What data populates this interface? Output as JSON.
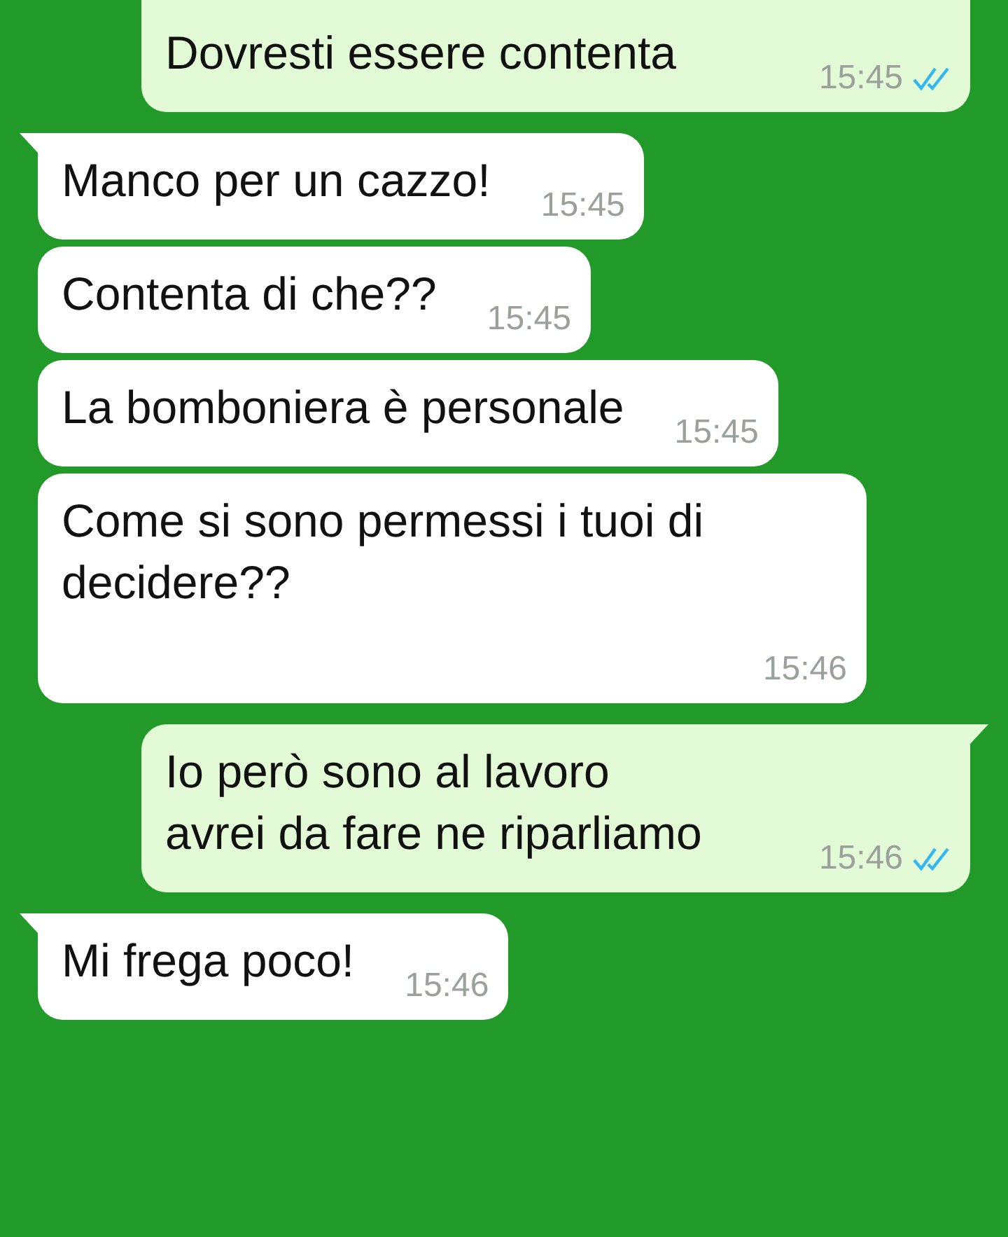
{
  "messages": [
    {
      "kind": "outgoing",
      "tail": false,
      "text": "Dovresti essere contenta",
      "time": "15:45",
      "read": true
    },
    {
      "kind": "incoming",
      "tail": true,
      "text": "Manco per un cazzo!",
      "time": "15:45"
    },
    {
      "kind": "incoming",
      "tail": false,
      "text": "Contenta di che??",
      "time": "15:45"
    },
    {
      "kind": "incoming",
      "tail": false,
      "text": "La bomboniera è personale",
      "time": "15:45"
    },
    {
      "kind": "incoming",
      "tail": false,
      "text": "Come si sono permessi i tuoi di decidere??",
      "time": "15:46"
    },
    {
      "kind": "outgoing",
      "tail": true,
      "text": "Io però sono al lavoro\navrei da fare ne riparliamo",
      "time": "15:46",
      "read": true
    },
    {
      "kind": "incoming",
      "tail": true,
      "text": "Mi frega poco!",
      "time": "15:46"
    }
  ]
}
